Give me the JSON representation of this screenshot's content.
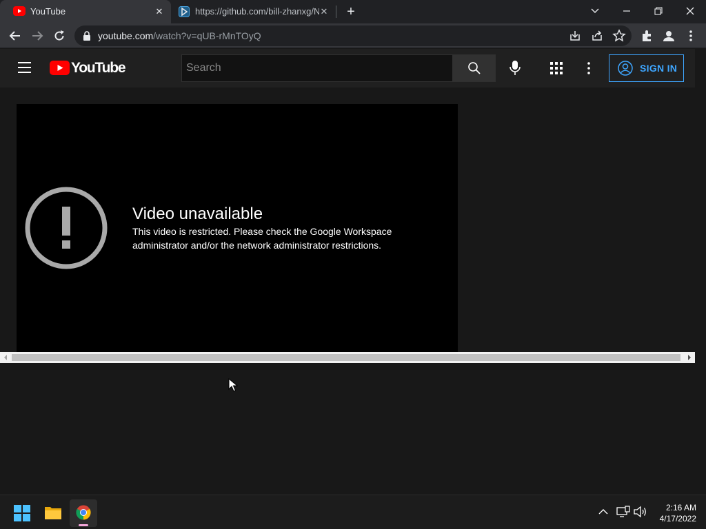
{
  "browser": {
    "tabs": [
      {
        "title": "YouTube",
        "active": true
      },
      {
        "title": "https://github.com/bill-zhanxg/N",
        "active": false
      }
    ],
    "url_host": "youtube.com",
    "url_path": "/watch?v=qUB-rMnTOyQ"
  },
  "youtube": {
    "logo_text": "YouTube",
    "search_placeholder": "Search",
    "signin_label": "SIGN IN"
  },
  "player": {
    "error_title": "Video unavailable",
    "error_message": "This video is restricted. Please check the Google Workspace administrator and/or the network administrator restrictions."
  },
  "taskbar": {
    "time": "2:16 AM",
    "date": "4/17/2022"
  },
  "colors": {
    "youtube_red": "#ff0000",
    "signin_blue": "#3ea6ff",
    "page_bg": "#181818",
    "header_bg": "#202020"
  }
}
